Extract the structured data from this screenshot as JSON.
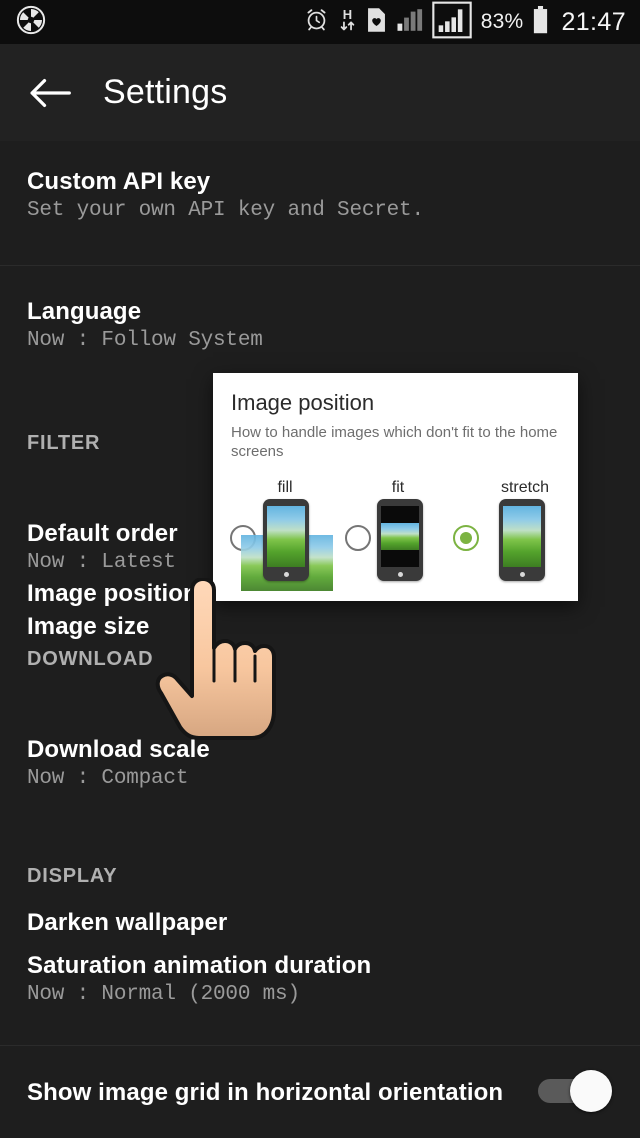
{
  "status_bar": {
    "app_icon": "aperture-icon",
    "icons": [
      "alarm-clock-icon",
      "hspa-data-icon",
      "heart-document-icon",
      "signal-bars-sim1-icon",
      "signal-bars-sim2-icon"
    ],
    "battery_percent": "83%",
    "battery_icon": "battery-full-icon",
    "time": "21:47"
  },
  "toolbar": {
    "back_icon": "arrow-back-icon",
    "title": "Settings"
  },
  "preferences": [
    {
      "title": "Custom API key",
      "summary": "Set your own API key and Secret."
    },
    {
      "title": "Language",
      "summary": "Now : Follow System"
    }
  ],
  "categories": {
    "filter": "FILTER",
    "download": "DOWNLOAD",
    "display": "DISPLAY"
  },
  "filter_items": [
    {
      "title": "Default order",
      "summary": "Now : Latest"
    },
    {
      "title": "Image position",
      "summary": ""
    },
    {
      "title": "Image size",
      "summary": ""
    }
  ],
  "download_items": [
    {
      "title": "Download scale",
      "summary": "Now : Compact"
    }
  ],
  "display_items": [
    {
      "title": "Darken wallpaper",
      "summary": ""
    },
    {
      "title": "Saturation animation duration",
      "summary": "Now : Normal  (2000 ms)"
    }
  ],
  "bottom_item": {
    "title": "Show image grid in horizontal orientation",
    "switch_state": "on"
  },
  "dialog": {
    "title": "Image position",
    "message": "How to handle images which don't fit to the home screens",
    "options": [
      {
        "label": "fill",
        "selected": false,
        "illustration": "phone-fill-illustration"
      },
      {
        "label": "fit",
        "selected": false,
        "illustration": "phone-fit-illustration"
      },
      {
        "label": "stretch",
        "selected": true,
        "illustration": "phone-stretch-illustration"
      }
    ]
  },
  "overlay": {
    "cursor": "hand-pointer-cursor"
  },
  "colors": {
    "background": "#1e1e1e",
    "toolbar": "#222222",
    "status_bar": "#0d0d0d",
    "accent_green": "#7cb342",
    "title_text": "#ffffff",
    "summary_text": "#9a9a9a",
    "category_text": "#b0b0b0",
    "dialog_background": "#ffffff"
  }
}
